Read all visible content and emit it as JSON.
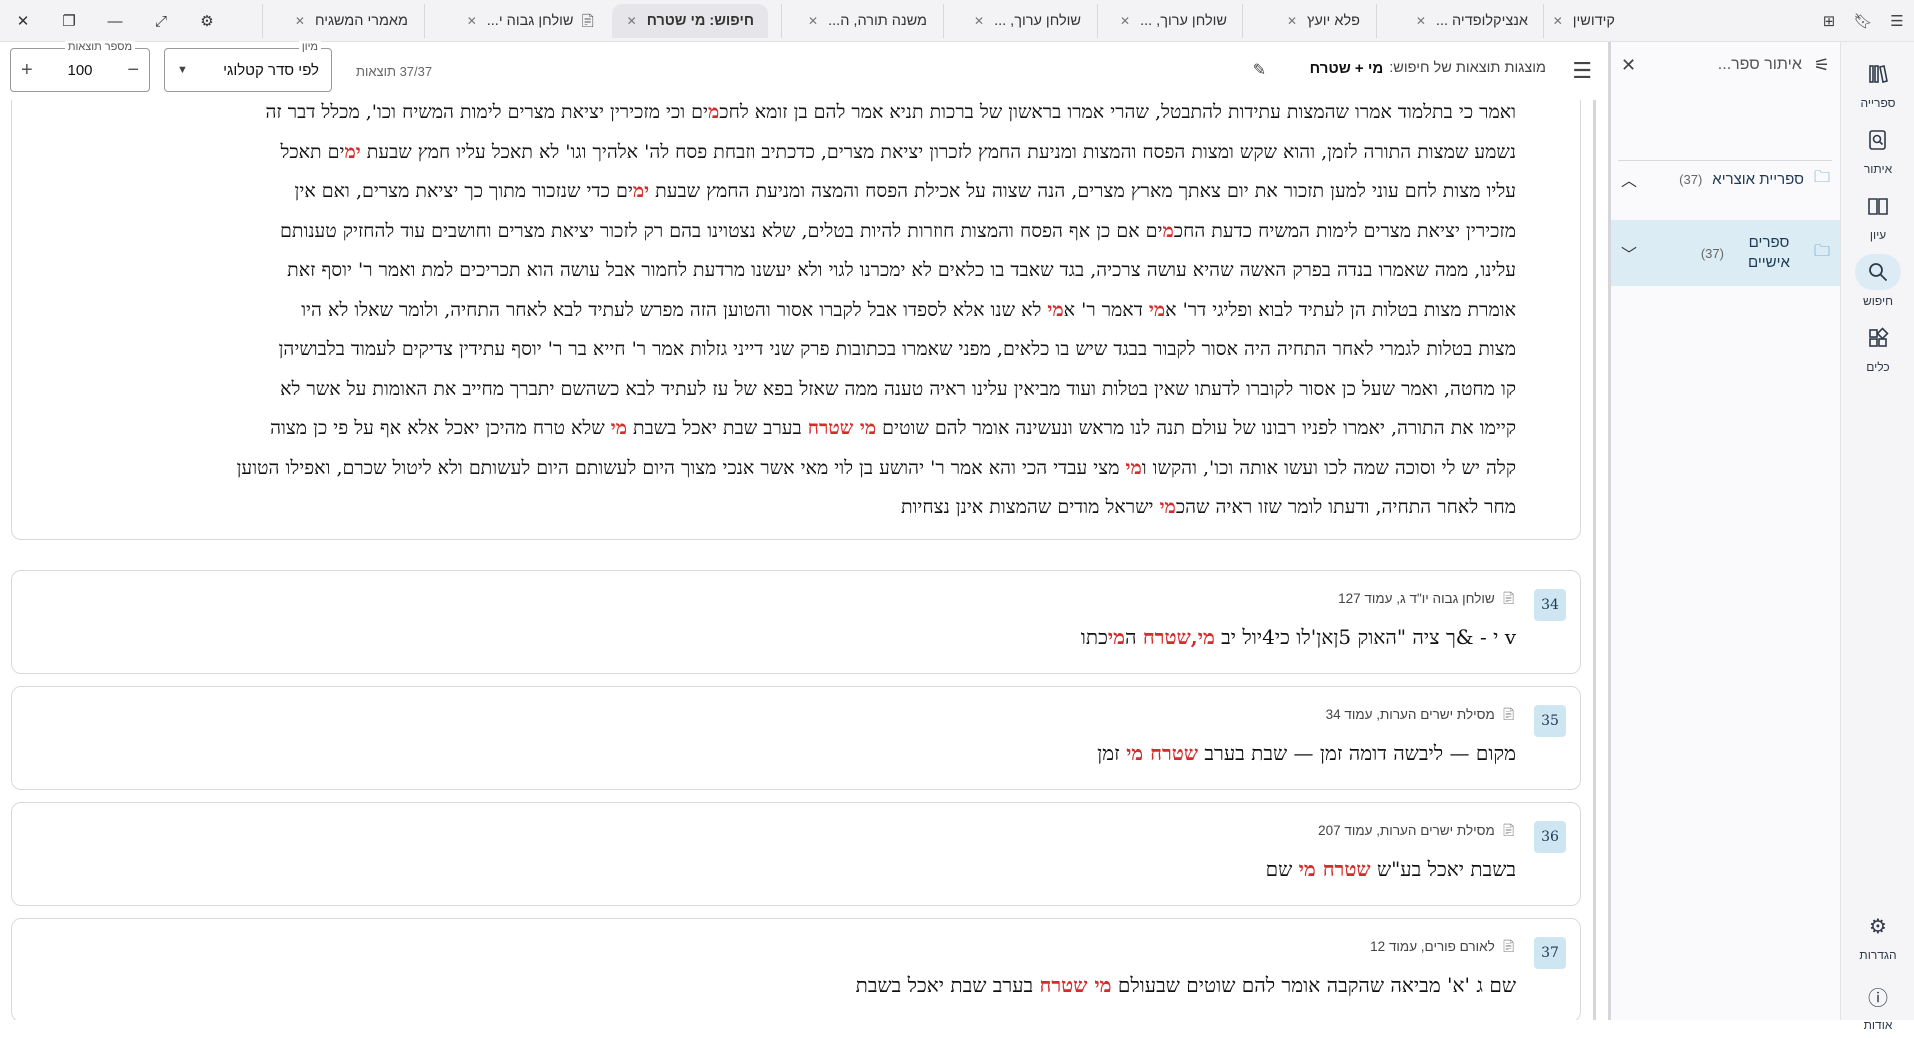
{
  "window": {
    "controls": [
      "close-icon",
      "restore-icon",
      "minimize-icon",
      "fullscreen-icon",
      "settings-icon"
    ]
  },
  "tabs": [
    {
      "label": "קידושין"
    },
    {
      "label": "אנציקלופדיה ..."
    },
    {
      "label": "פלא יועץ"
    },
    {
      "label": "שולחן ערוך, ..."
    },
    {
      "label": "שולחן ערוך, ..."
    },
    {
      "label": "משנה תורה, ה..."
    },
    {
      "label": "חיפוש: מי שטרח",
      "active": true
    },
    {
      "label": "שולחן גבוה י..."
    },
    {
      "label": "מאמרי המשגיח"
    }
  ],
  "rail": {
    "items": [
      {
        "label": "ספרייה",
        "icon": "library-icon"
      },
      {
        "label": "איתור",
        "icon": "find-icon"
      },
      {
        "label": "עיון",
        "icon": "book-icon"
      },
      {
        "label": "חיפוש",
        "icon": "search-icon",
        "active": true
      },
      {
        "label": "כלים",
        "icon": "tools-icon"
      }
    ],
    "bottom": [
      {
        "label": "הגדרות",
        "icon": "settings-icon"
      },
      {
        "label": "אודות",
        "icon": "info-icon"
      }
    ]
  },
  "panel": {
    "filter_placeholder": "איתור ספר...",
    "tree": [
      {
        "label": "ספריית אוצריא",
        "count": "(37)"
      },
      {
        "label": "ספרים אישיים",
        "count": "(37)"
      }
    ]
  },
  "header": {
    "caption": "מוצגות תוצאות של חיפוש:",
    "query": "מי + שטרח",
    "results_count": "37/37 תוצאות",
    "sort_legend": "מיון",
    "sort_value": "לפי סדר קטלוגי",
    "num_legend": "מספר תוצאות",
    "num_value": "100"
  },
  "big_result": {
    "lines": [
      [
        "ואמר כי בתלמוד אמרו שהמצות עתידות להתבטל, שהרי אמרו בראשון של ברכות תניא אמר להם בן זומא לחכ",
        {
          "hl": "מ"
        },
        "ים וכי מזכירין יציאת מצרים לימות המשיח וכו', מכלל דבר זה"
      ],
      [
        "נשמע שמצות התורה לזמן, והוא שקש ומצות הפסח והמצות ומניעת החמץ לזכרון יציאת מצרים, כדכתיב וזבחת פסח לה' אלהיך וגו' לא תאכל עליו חמץ שבעת ",
        {
          "hl": "ימ"
        },
        "ים תאכל"
      ],
      [
        "עליו מצות לחם עוני למען תזכור את יום צאתך מארץ מצרים, הנה שצוה על אכילת הפסח והמצה ומניעת החמץ שבעת ",
        {
          "hl": "ימ"
        },
        "ים כדי שנזכור מתוך כך יציאת מצרים, ואם אין"
      ],
      [
        "מזכירין יציאת מצרים לימות המשיח כדעת החכ",
        {
          "hl": "מ"
        },
        "ים אם כן אף הפסח והמצות חוזרות להיות בטלים, שלא נצטוינו בהם רק לזכור יציאת מצרים וחושבים עוד להחזיק טענותם"
      ],
      [
        "עלינו, ממה שאמרו בנדה בפרק האשה שהיא עושה צרכיה, בגד שאבד בו כלאים לא ימכרנו לגוי ולא יעשנו מרדעת לחמור אבל עושה הוא תכריכים למת ואמר ר' יוסף זאת"
      ],
      [
        "אומרת מצות בטלות הן לעתיד לבוא ופליגי דר' א",
        {
          "hl": "מי"
        },
        " דאמר ר' א",
        {
          "hl": "מי"
        },
        " לא שנו אלא לספדו אבל לקברו אסור והטוען הזה מפרש לעתיד לבא לאחר התחיה, ולומר שאלו לא היו"
      ],
      [
        "מצות בטלות לגמרי לאחר התחיה היה אסור לקבור בבגד שיש בו כלאים, מפני שאמרו בכתובות פרק שני דייני גזלות אמר ר' חייא בר ר' יוסף עתידין צדיקים לעמוד בלבושיהן"
      ],
      [
        "קו מחטה, ואמר שעל כן אסור לקוברו לדעתו שאין בטלות ועוד מביאין עלינו ראיה טענה ממה שאזל בפא של עז לעתיד לבא כשהשם יתברך מחייב את האומות על אשר לא"
      ],
      [
        "קיימו את התורה, יאמרו לפניו רבונו של עולם תנה לנו מראש ונעשינה אומר להם שוטים ",
        {
          "hl": "מי שטרח"
        },
        " בערב שבת יאכל בשבת ",
        {
          "hl": "מי"
        },
        " שלא טרח מהיכן יאכל אלא אף על פי כן מצוה"
      ],
      [
        "קלה יש לי וסוכה שמה לכו ועשו אותה וכו', והקשו ו",
        {
          "hl": "מי"
        },
        " מצי עבדי הכי והא אמר ר' יהושע בן לוי מאי אשר אנכי מצוך היום לעשותם היום לעשותם ולא ליטול שכרם, ואפילו הטוען"
      ],
      [
        "מחר לאחר התחיה, ודעתו לומר שזו ראיה שהכ",
        {
          "hl": "מי"
        },
        " ישראל מודים שהמצות אינן נצחיות"
      ]
    ]
  },
  "results": [
    {
      "num": "34",
      "source": "שולחן גבוה יו\"ד ג, עמוד 127",
      "snippet": [
        "v    י   - &ך ציה \"האוק 5ןאן'לו כי4יול יב ",
        {
          "hl": "מי,שטרח"
        },
        " ה",
        {
          "hl": "מי"
        },
        "כתו"
      ]
    },
    {
      "num": "35",
      "source": "מסילת ישרים הערות, עמוד 34",
      "snippet": [
        "מקום — ליבשה דומה זמן — שבת בערב ",
        {
          "hl": "שטרח מי"
        },
        " זמן"
      ]
    },
    {
      "num": "36",
      "source": "מסילת ישרים הערות, עמוד 207",
      "snippet": [
        "בשבת יאכל בע\"ש ",
        {
          "hl": "שטרח מי"
        },
        " שם"
      ]
    },
    {
      "num": "37",
      "source": "לאורם פורים, עמוד 12",
      "snippet": [
        "שם ג 'א' מביאה שהקבה אומר להם שוטים שבעולם ",
        {
          "hl": "מי שטרח"
        },
        " בערב שבת יאכל בשבת"
      ]
    }
  ],
  "colors": {
    "highlight": "#d42b2b",
    "badge_bg": "#cde6f2",
    "selected_tree_bg": "#dcecf5",
    "accent": "#2b7fb3"
  }
}
